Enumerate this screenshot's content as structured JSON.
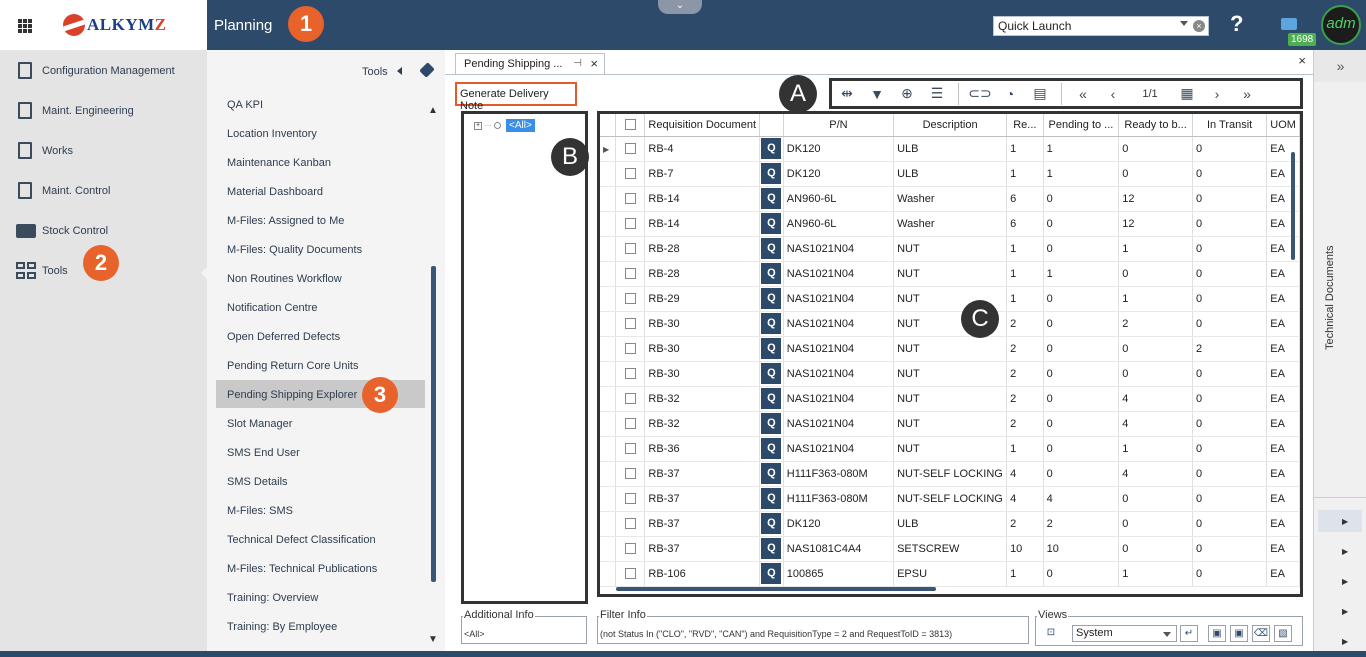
{
  "header": {
    "logo_text_main": "ALKYM",
    "logo_text_z": "Z",
    "module_title": "Planning",
    "quick_launch_value": "Quick Launch",
    "help_glyph": "?",
    "chat_count": "1698",
    "avatar_text": "adm",
    "collapse_glyph": "⌄"
  },
  "badges": {
    "one": "1",
    "two": "2",
    "three": "3",
    "a": "A",
    "b": "B",
    "c": "C"
  },
  "left_nav": [
    {
      "label": "Configuration Management",
      "icon": "doc-edit-icon"
    },
    {
      "label": "Maint. Engineering",
      "icon": "gear-doc-icon"
    },
    {
      "label": "Works",
      "icon": "works-icon"
    },
    {
      "label": "Maint. Control",
      "icon": "control-icon"
    },
    {
      "label": "Stock Control",
      "icon": "truck-icon"
    },
    {
      "label": "Tools",
      "icon": "tiles-icon"
    }
  ],
  "tools_panel": {
    "title": "Tools",
    "items": [
      "QA KPI",
      "Location Inventory",
      "Maintenance Kanban",
      "Material Dashboard",
      "M-Files: Assigned to Me",
      "M-Files: Quality Documents",
      "Non Routines Workflow",
      "Notification Centre",
      "Open Deferred Defects",
      "Pending Return Core Units",
      "Pending Shipping Explorer",
      "Slot Manager",
      "SMS End User",
      "SMS Details",
      "M-Files: SMS",
      "Technical Defect Classification",
      "M-Files: Technical Publications",
      "Training: Overview",
      "Training: By Employee"
    ],
    "selected": "Pending Shipping Explorer"
  },
  "document": {
    "tab_label": "Pending Shipping ...",
    "generate_button": "Generate Delivery Note",
    "page_indicator": "1/1",
    "tree_root": "<All>"
  },
  "grid": {
    "columns": [
      "",
      "",
      "Requisition Document",
      "",
      "P/N",
      "Description",
      "Re...",
      "Pending to ...",
      "Ready to b...",
      "In Transit",
      "UOM"
    ],
    "rows": [
      [
        "RB-4",
        "DK120",
        "ULB",
        "1",
        "1",
        "0",
        "0",
        "EA"
      ],
      [
        "RB-7",
        "DK120",
        "ULB",
        "1",
        "1",
        "0",
        "0",
        "EA"
      ],
      [
        "RB-14",
        "AN960-6L",
        "Washer",
        "6",
        "0",
        "12",
        "0",
        "EA"
      ],
      [
        "RB-14",
        "AN960-6L",
        "Washer",
        "6",
        "0",
        "12",
        "0",
        "EA"
      ],
      [
        "RB-28",
        "NAS1021N04",
        "NUT",
        "1",
        "0",
        "1",
        "0",
        "EA"
      ],
      [
        "RB-28",
        "NAS1021N04",
        "NUT",
        "1",
        "1",
        "0",
        "0",
        "EA"
      ],
      [
        "RB-29",
        "NAS1021N04",
        "NUT",
        "1",
        "0",
        "1",
        "0",
        "EA"
      ],
      [
        "RB-30",
        "NAS1021N04",
        "NUT",
        "2",
        "0",
        "2",
        "0",
        "EA"
      ],
      [
        "RB-30",
        "NAS1021N04",
        "NUT",
        "2",
        "0",
        "0",
        "2",
        "EA"
      ],
      [
        "RB-30",
        "NAS1021N04",
        "NUT",
        "2",
        "0",
        "0",
        "0",
        "EA"
      ],
      [
        "RB-32",
        "NAS1021N04",
        "NUT",
        "2",
        "0",
        "4",
        "0",
        "EA"
      ],
      [
        "RB-32",
        "NAS1021N04",
        "NUT",
        "2",
        "0",
        "4",
        "0",
        "EA"
      ],
      [
        "RB-36",
        "NAS1021N04",
        "NUT",
        "1",
        "0",
        "1",
        "0",
        "EA"
      ],
      [
        "RB-37",
        "H111F363-080M",
        "NUT-SELF LOCKING",
        "4",
        "0",
        "4",
        "0",
        "EA"
      ],
      [
        "RB-37",
        "H111F363-080M",
        "NUT-SELF LOCKING",
        "4",
        "4",
        "0",
        "0",
        "EA"
      ],
      [
        "RB-37",
        "DK120",
        "ULB",
        "2",
        "2",
        "0",
        "0",
        "EA"
      ],
      [
        "RB-37",
        "NAS1081C4A4",
        "SETSCREW",
        "10",
        "10",
        "0",
        "0",
        "EA"
      ],
      [
        "RB-106",
        "100865",
        "EPSU",
        "1",
        "0",
        "1",
        "0",
        "EA"
      ]
    ]
  },
  "bottom": {
    "additional_info_label": "Additional Info",
    "additional_info_value": "<All>",
    "filter_info_label": "Filter Info",
    "filter_info_value": "(not Status In (\"CLO\", \"RVD\", \"CAN\") and RequisitionType = 2 and RequestToID = 3813)",
    "views_label": "Views",
    "views_value": "System"
  },
  "right_rail": {
    "label": "Technical Documents",
    "expand_glyph": "»"
  },
  "colors": {
    "header_bg": "#2e4a6b",
    "accent_orange": "#e8632b",
    "selection_blue": "#3a8ee6"
  }
}
